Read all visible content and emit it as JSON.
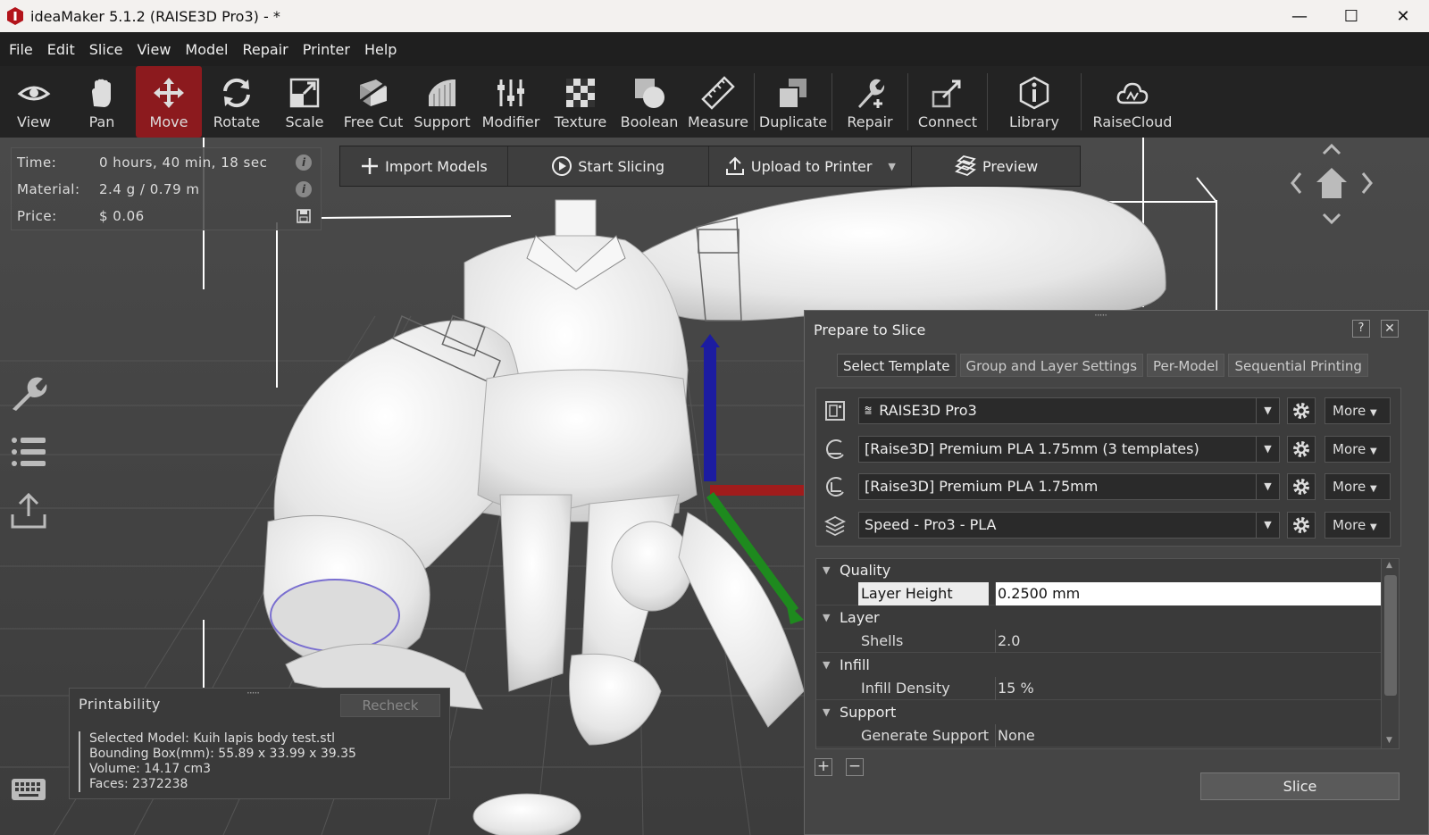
{
  "window": {
    "title": "ideaMaker 5.1.2 (RAISE3D Pro3) - *",
    "minimize": "—",
    "maximize": "☐",
    "close": "✕"
  },
  "menu": [
    "File",
    "Edit",
    "Slice",
    "View",
    "Model",
    "Repair",
    "Printer",
    "Help"
  ],
  "toolbar": {
    "tools": [
      {
        "label": "View",
        "icon": "eye-icon"
      },
      {
        "label": "Pan",
        "icon": "hand-icon"
      },
      {
        "label": "Move",
        "icon": "move-icon",
        "active": true
      },
      {
        "label": "Rotate",
        "icon": "rotate-icon"
      },
      {
        "label": "Scale",
        "icon": "scale-icon"
      },
      {
        "label": "Free Cut",
        "icon": "free-cut-icon"
      },
      {
        "label": "Support",
        "icon": "support-icon"
      },
      {
        "label": "Modifier",
        "icon": "modifier-icon"
      },
      {
        "label": "Texture",
        "icon": "texture-icon"
      },
      {
        "label": "Boolean",
        "icon": "boolean-icon"
      },
      {
        "label": "Measure",
        "icon": "measure-icon"
      },
      {
        "label": "Duplicate",
        "icon": "duplicate-icon"
      },
      {
        "label": "Repair",
        "icon": "repair-icon"
      },
      {
        "label": "Connect",
        "icon": "connect-icon"
      },
      {
        "label": "Library",
        "icon": "library-icon"
      },
      {
        "label": "RaiseCloud",
        "icon": "cloud-icon"
      }
    ],
    "active_color": "#8c1a1e"
  },
  "stats": {
    "time_label": "Time:",
    "time_value": "0 hours, 40 min, 18 sec",
    "material_label": "Material:",
    "material_value": "2.4 g / 0.79 m",
    "price_label": "Price:",
    "price_value": "$ 0.06"
  },
  "actions": {
    "import": "Import Models",
    "start_slicing": "Start Slicing",
    "upload": "Upload to Printer",
    "preview": "Preview"
  },
  "printability": {
    "title": "Printability",
    "recheck": "Recheck",
    "selected_model": "Selected Model: Kuih lapis body test.stl",
    "bounding_box": "Bounding Box(mm): 55.89 x 33.99 x 39.35",
    "volume": "Volume: 14.17 cm3",
    "faces": "Faces: 2372238"
  },
  "prepare": {
    "title": "Prepare to Slice",
    "help": "?",
    "close": "✕",
    "tabs": [
      "Select Template",
      "Group and Layer Settings",
      "Per-Model",
      "Sequential Printing"
    ],
    "templates": [
      {
        "value": "RAISE3D Pro3",
        "more": "More",
        "icon": "printer-icon"
      },
      {
        "value": "[Raise3D] Premium PLA 1.75mm (3 templates)",
        "more": "More",
        "icon": "filament-left-icon"
      },
      {
        "value": "[Raise3D] Premium PLA 1.75mm",
        "more": "More",
        "icon": "filament-right-icon"
      },
      {
        "value": "Speed - Pro3 - PLA",
        "more": "More",
        "icon": "layers-icon"
      }
    ],
    "params": {
      "quality": "Quality",
      "layer_height_label": "Layer Height",
      "layer_height_value": "0.2500 mm",
      "layer": "Layer",
      "shells_label": "Shells",
      "shells_value": "2.0",
      "infill": "Infill",
      "infill_density_label": "Infill Density",
      "infill_density_value": "15 %",
      "support": "Support",
      "generate_support_label": "Generate Support",
      "generate_support_value": "None"
    },
    "add": "+",
    "remove": "−",
    "slice": "Slice"
  }
}
